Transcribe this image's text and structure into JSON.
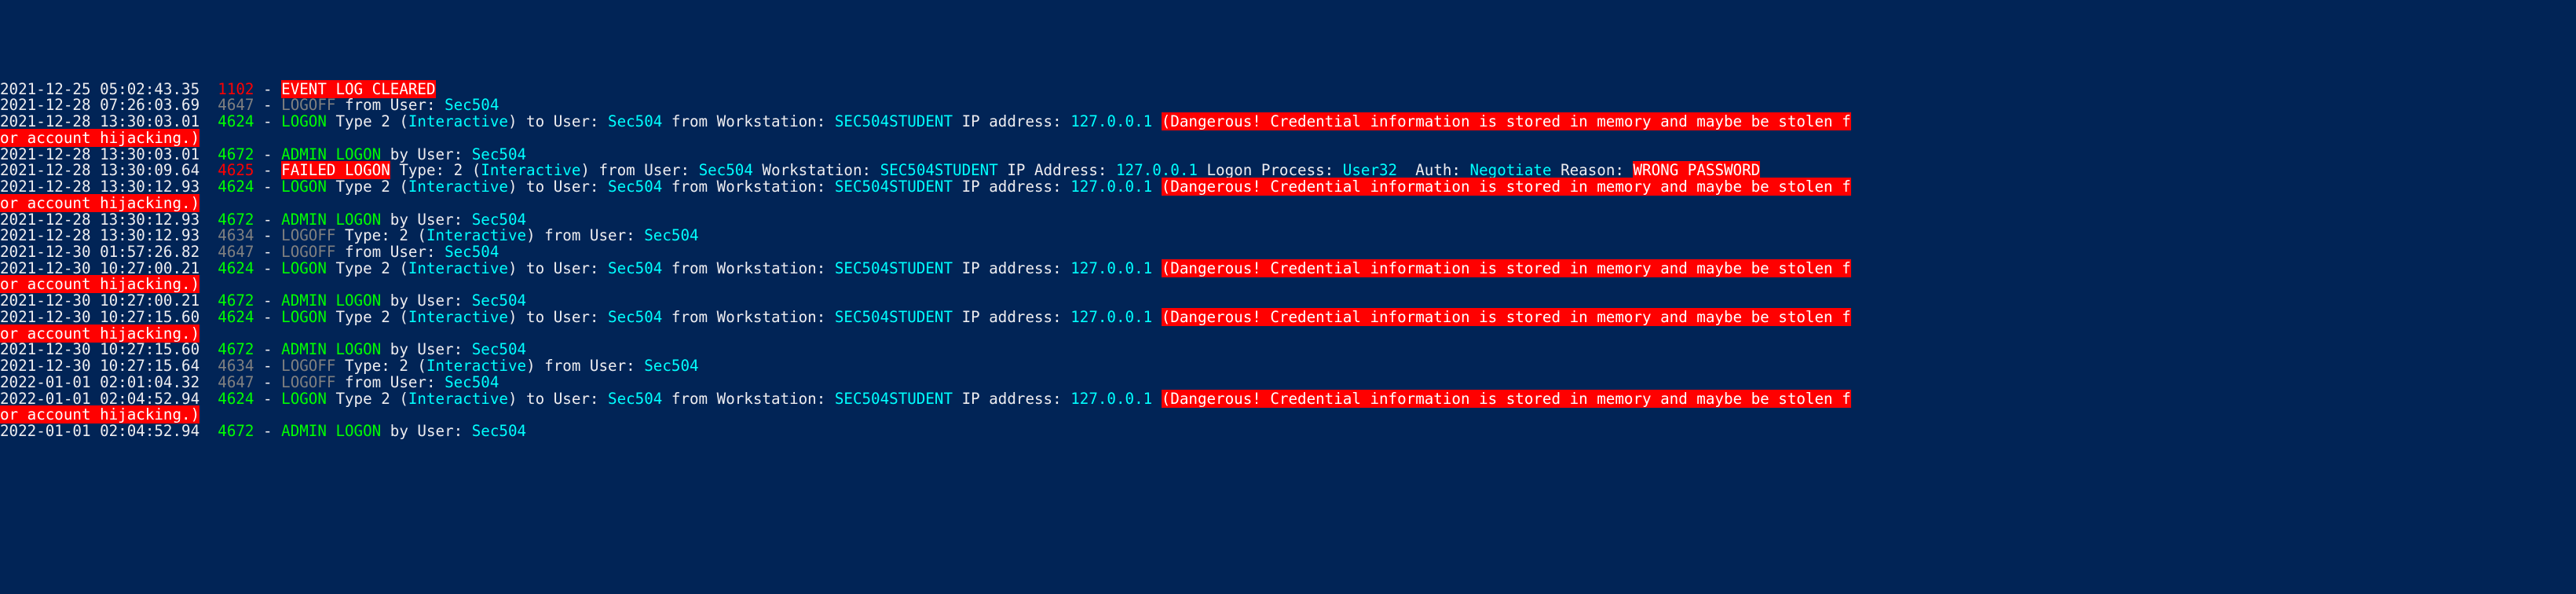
{
  "entries": [
    {
      "ts": "2021-12-25 05:02:43.35",
      "segs": [
        {
          "txt": "  ",
          "cls": "white"
        },
        {
          "txt": "1102",
          "cls": "red"
        },
        {
          "txt": " - ",
          "cls": "white"
        },
        {
          "txt": "EVENT LOG CLEARED",
          "cls": "hl-red"
        }
      ]
    },
    {
      "ts": "2021-12-28 07:26:03.69",
      "segs": [
        {
          "txt": "  ",
          "cls": "white"
        },
        {
          "txt": "4647",
          "cls": "gray"
        },
        {
          "txt": " - ",
          "cls": "white"
        },
        {
          "txt": "LOGOFF",
          "cls": "gray"
        },
        {
          "txt": " from User: ",
          "cls": "white"
        },
        {
          "txt": "Sec504",
          "cls": "cyan"
        }
      ]
    },
    {
      "ts": "2021-12-28 13:30:03.01",
      "segs": [
        {
          "txt": "  ",
          "cls": "white"
        },
        {
          "txt": "4624",
          "cls": "green"
        },
        {
          "txt": " - ",
          "cls": "white"
        },
        {
          "txt": "LOGON",
          "cls": "green"
        },
        {
          "txt": " Type 2 (",
          "cls": "white"
        },
        {
          "txt": "Interactive",
          "cls": "cyan"
        },
        {
          "txt": ") to User: ",
          "cls": "white"
        },
        {
          "txt": "Sec504",
          "cls": "cyan"
        },
        {
          "txt": " from Workstation: ",
          "cls": "white"
        },
        {
          "txt": "SEC504STUDENT",
          "cls": "cyan"
        },
        {
          "txt": " IP address: ",
          "cls": "white"
        },
        {
          "txt": "127.0.0.1",
          "cls": "cyan"
        },
        {
          "txt": " ",
          "cls": "white"
        },
        {
          "txt": "(Dangerous! Credential information is stored in memory and maybe be stolen f",
          "cls": "hl-red"
        }
      ]
    },
    {
      "ts": "",
      "segs": [
        {
          "txt": "or account hijacking.)",
          "cls": "hl-red"
        }
      ]
    },
    {
      "ts": "2021-12-28 13:30:03.01",
      "segs": [
        {
          "txt": "  ",
          "cls": "white"
        },
        {
          "txt": "4672",
          "cls": "green"
        },
        {
          "txt": " - ",
          "cls": "white"
        },
        {
          "txt": "ADMIN LOGON",
          "cls": "green"
        },
        {
          "txt": " by User: ",
          "cls": "white"
        },
        {
          "txt": "Sec504",
          "cls": "cyan"
        }
      ]
    },
    {
      "ts": "2021-12-28 13:30:09.64",
      "segs": [
        {
          "txt": "  ",
          "cls": "white"
        },
        {
          "txt": "4625",
          "cls": "red"
        },
        {
          "txt": " - ",
          "cls": "white"
        },
        {
          "txt": "FAILED LOGON",
          "cls": "hl-red"
        },
        {
          "txt": " Type: 2 (",
          "cls": "white"
        },
        {
          "txt": "Interactive",
          "cls": "cyan"
        },
        {
          "txt": ") from User: ",
          "cls": "white"
        },
        {
          "txt": "Sec504",
          "cls": "cyan"
        },
        {
          "txt": " Workstation: ",
          "cls": "white"
        },
        {
          "txt": "SEC504STUDENT",
          "cls": "cyan"
        },
        {
          "txt": " IP Address: ",
          "cls": "white"
        },
        {
          "txt": "127.0.0.1",
          "cls": "cyan"
        },
        {
          "txt": " Logon Process: ",
          "cls": "white"
        },
        {
          "txt": "User32 ",
          "cls": "cyan"
        },
        {
          "txt": " Auth: ",
          "cls": "white"
        },
        {
          "txt": "Negotiate",
          "cls": "cyan"
        },
        {
          "txt": " Reason: ",
          "cls": "white"
        },
        {
          "txt": "WRONG PASSWORD",
          "cls": "hl-red"
        }
      ]
    },
    {
      "ts": "2021-12-28 13:30:12.93",
      "segs": [
        {
          "txt": "  ",
          "cls": "white"
        },
        {
          "txt": "4624",
          "cls": "green"
        },
        {
          "txt": " - ",
          "cls": "white"
        },
        {
          "txt": "LOGON",
          "cls": "green"
        },
        {
          "txt": " Type 2 (",
          "cls": "white"
        },
        {
          "txt": "Interactive",
          "cls": "cyan"
        },
        {
          "txt": ") to User: ",
          "cls": "white"
        },
        {
          "txt": "Sec504",
          "cls": "cyan"
        },
        {
          "txt": " from Workstation: ",
          "cls": "white"
        },
        {
          "txt": "SEC504STUDENT",
          "cls": "cyan"
        },
        {
          "txt": " IP address: ",
          "cls": "white"
        },
        {
          "txt": "127.0.0.1",
          "cls": "cyan"
        },
        {
          "txt": " ",
          "cls": "white"
        },
        {
          "txt": "(Dangerous! Credential information is stored in memory and maybe be stolen f",
          "cls": "hl-red"
        }
      ]
    },
    {
      "ts": "",
      "segs": [
        {
          "txt": "or account hijacking.)",
          "cls": "hl-red"
        }
      ]
    },
    {
      "ts": "2021-12-28 13:30:12.93",
      "segs": [
        {
          "txt": "  ",
          "cls": "white"
        },
        {
          "txt": "4672",
          "cls": "green"
        },
        {
          "txt": " - ",
          "cls": "white"
        },
        {
          "txt": "ADMIN LOGON",
          "cls": "green"
        },
        {
          "txt": " by User: ",
          "cls": "white"
        },
        {
          "txt": "Sec504",
          "cls": "cyan"
        }
      ]
    },
    {
      "ts": "2021-12-28 13:30:12.93",
      "segs": [
        {
          "txt": "  ",
          "cls": "white"
        },
        {
          "txt": "4634",
          "cls": "gray"
        },
        {
          "txt": " - ",
          "cls": "white"
        },
        {
          "txt": "LOGOFF",
          "cls": "gray"
        },
        {
          "txt": " Type: 2 (",
          "cls": "white"
        },
        {
          "txt": "Interactive",
          "cls": "cyan"
        },
        {
          "txt": ") from User: ",
          "cls": "white"
        },
        {
          "txt": "Sec504",
          "cls": "cyan"
        }
      ]
    },
    {
      "ts": "2021-12-30 01:57:26.82",
      "segs": [
        {
          "txt": "  ",
          "cls": "white"
        },
        {
          "txt": "4647",
          "cls": "gray"
        },
        {
          "txt": " - ",
          "cls": "white"
        },
        {
          "txt": "LOGOFF",
          "cls": "gray"
        },
        {
          "txt": " from User: ",
          "cls": "white"
        },
        {
          "txt": "Sec504",
          "cls": "cyan"
        }
      ]
    },
    {
      "ts": "2021-12-30 10:27:00.21",
      "segs": [
        {
          "txt": "  ",
          "cls": "white"
        },
        {
          "txt": "4624",
          "cls": "green"
        },
        {
          "txt": " - ",
          "cls": "white"
        },
        {
          "txt": "LOGON",
          "cls": "green"
        },
        {
          "txt": " Type 2 (",
          "cls": "white"
        },
        {
          "txt": "Interactive",
          "cls": "cyan"
        },
        {
          "txt": ") to User: ",
          "cls": "white"
        },
        {
          "txt": "Sec504",
          "cls": "cyan"
        },
        {
          "txt": " from Workstation: ",
          "cls": "white"
        },
        {
          "txt": "SEC504STUDENT",
          "cls": "cyan"
        },
        {
          "txt": " IP address: ",
          "cls": "white"
        },
        {
          "txt": "127.0.0.1",
          "cls": "cyan"
        },
        {
          "txt": " ",
          "cls": "white"
        },
        {
          "txt": "(Dangerous! Credential information is stored in memory and maybe be stolen f",
          "cls": "hl-red"
        }
      ]
    },
    {
      "ts": "",
      "segs": [
        {
          "txt": "or account hijacking.)",
          "cls": "hl-red"
        }
      ]
    },
    {
      "ts": "2021-12-30 10:27:00.21",
      "segs": [
        {
          "txt": "  ",
          "cls": "white"
        },
        {
          "txt": "4672",
          "cls": "green"
        },
        {
          "txt": " - ",
          "cls": "white"
        },
        {
          "txt": "ADMIN LOGON",
          "cls": "green"
        },
        {
          "txt": " by User: ",
          "cls": "white"
        },
        {
          "txt": "Sec504",
          "cls": "cyan"
        }
      ]
    },
    {
      "ts": "2021-12-30 10:27:15.60",
      "segs": [
        {
          "txt": "  ",
          "cls": "white"
        },
        {
          "txt": "4624",
          "cls": "green"
        },
        {
          "txt": " - ",
          "cls": "white"
        },
        {
          "txt": "LOGON",
          "cls": "green"
        },
        {
          "txt": " Type 2 (",
          "cls": "white"
        },
        {
          "txt": "Interactive",
          "cls": "cyan"
        },
        {
          "txt": ") to User: ",
          "cls": "white"
        },
        {
          "txt": "Sec504",
          "cls": "cyan"
        },
        {
          "txt": " from Workstation: ",
          "cls": "white"
        },
        {
          "txt": "SEC504STUDENT",
          "cls": "cyan"
        },
        {
          "txt": " IP address: ",
          "cls": "white"
        },
        {
          "txt": "127.0.0.1",
          "cls": "cyan"
        },
        {
          "txt": " ",
          "cls": "white"
        },
        {
          "txt": "(Dangerous! Credential information is stored in memory and maybe be stolen f",
          "cls": "hl-red"
        }
      ]
    },
    {
      "ts": "",
      "segs": [
        {
          "txt": "or account hijacking.)",
          "cls": "hl-red"
        }
      ]
    },
    {
      "ts": "2021-12-30 10:27:15.60",
      "segs": [
        {
          "txt": "  ",
          "cls": "white"
        },
        {
          "txt": "4672",
          "cls": "green"
        },
        {
          "txt": " - ",
          "cls": "white"
        },
        {
          "txt": "ADMIN LOGON",
          "cls": "green"
        },
        {
          "txt": " by User: ",
          "cls": "white"
        },
        {
          "txt": "Sec504",
          "cls": "cyan"
        }
      ]
    },
    {
      "ts": "2021-12-30 10:27:15.64",
      "segs": [
        {
          "txt": "  ",
          "cls": "white"
        },
        {
          "txt": "4634",
          "cls": "gray"
        },
        {
          "txt": " - ",
          "cls": "white"
        },
        {
          "txt": "LOGOFF",
          "cls": "gray"
        },
        {
          "txt": " Type: 2 (",
          "cls": "white"
        },
        {
          "txt": "Interactive",
          "cls": "cyan"
        },
        {
          "txt": ") from User: ",
          "cls": "white"
        },
        {
          "txt": "Sec504",
          "cls": "cyan"
        }
      ]
    },
    {
      "ts": "2022-01-01 02:01:04.32",
      "segs": [
        {
          "txt": "  ",
          "cls": "white"
        },
        {
          "txt": "4647",
          "cls": "gray"
        },
        {
          "txt": " - ",
          "cls": "white"
        },
        {
          "txt": "LOGOFF",
          "cls": "gray"
        },
        {
          "txt": " from User: ",
          "cls": "white"
        },
        {
          "txt": "Sec504",
          "cls": "cyan"
        }
      ]
    },
    {
      "ts": "2022-01-01 02:04:52.94",
      "segs": [
        {
          "txt": "  ",
          "cls": "white"
        },
        {
          "txt": "4624",
          "cls": "green"
        },
        {
          "txt": " - ",
          "cls": "white"
        },
        {
          "txt": "LOGON",
          "cls": "green"
        },
        {
          "txt": " Type 2 (",
          "cls": "white"
        },
        {
          "txt": "Interactive",
          "cls": "cyan"
        },
        {
          "txt": ") to User: ",
          "cls": "white"
        },
        {
          "txt": "Sec504",
          "cls": "cyan"
        },
        {
          "txt": " from Workstation: ",
          "cls": "white"
        },
        {
          "txt": "SEC504STUDENT",
          "cls": "cyan"
        },
        {
          "txt": " IP address: ",
          "cls": "white"
        },
        {
          "txt": "127.0.0.1",
          "cls": "cyan"
        },
        {
          "txt": " ",
          "cls": "white"
        },
        {
          "txt": "(Dangerous! Credential information is stored in memory and maybe be stolen f",
          "cls": "hl-red"
        }
      ]
    },
    {
      "ts": "",
      "segs": [
        {
          "txt": "or account hijacking.)",
          "cls": "hl-red"
        }
      ]
    },
    {
      "ts": "2022-01-01 02:04:52.94",
      "segs": [
        {
          "txt": "  ",
          "cls": "white"
        },
        {
          "txt": "4672",
          "cls": "green"
        },
        {
          "txt": " - ",
          "cls": "white"
        },
        {
          "txt": "ADMIN LOGON",
          "cls": "green"
        },
        {
          "txt": " by User: ",
          "cls": "white"
        },
        {
          "txt": "Sec504",
          "cls": "cyan"
        }
      ]
    }
  ]
}
